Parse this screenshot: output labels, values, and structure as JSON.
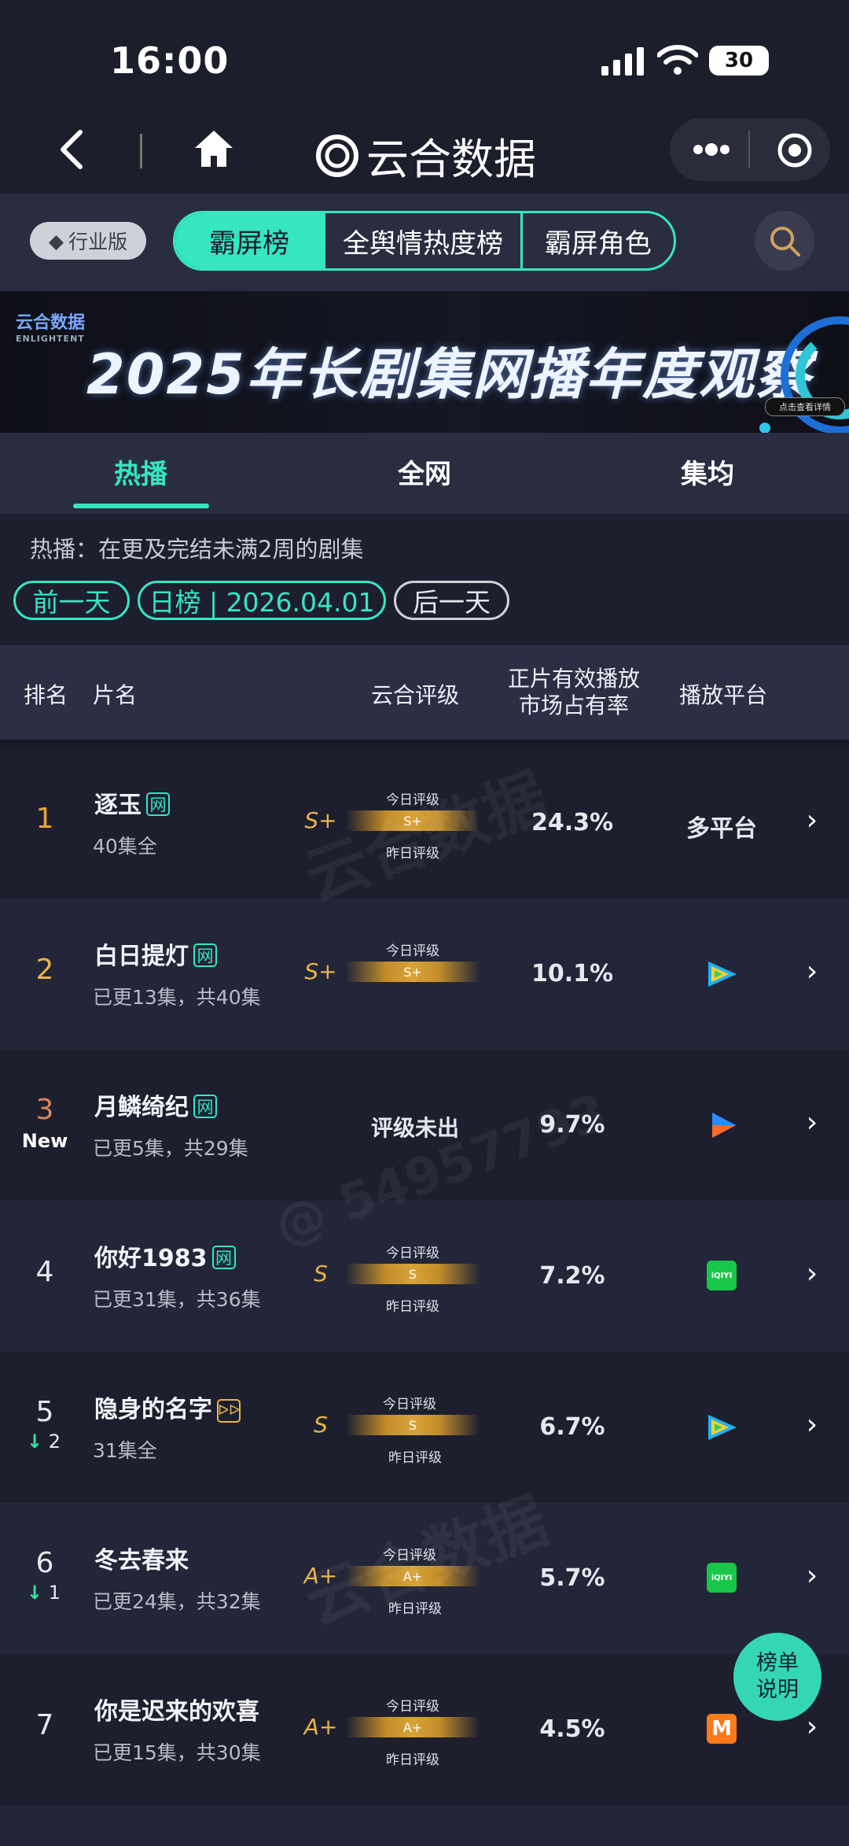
{
  "status": {
    "time": "16:00",
    "battery": "30"
  },
  "nav": {
    "title": "云合数据"
  },
  "toolbar": {
    "industry": "行业版",
    "segments": [
      "霸屏榜",
      "全舆情热度榜",
      "霸屏角色"
    ]
  },
  "banner": {
    "logo": "云合数据",
    "logo_sub": "ENLIGHTENT",
    "title": "2025年长剧集网播年度观察",
    "button": "点击查看详情"
  },
  "subtabs": [
    "热播",
    "全网",
    "集均"
  ],
  "filter": {
    "description": "热播：在更及完结未满2周的剧集",
    "prev": "前一天",
    "current": "日榜 | 2026.04.01",
    "next": "后一天"
  },
  "table_header": {
    "rank": "排名",
    "name": "片名",
    "rating": "云合评级",
    "share_line1": "正片有效播放",
    "share_line2": "市场占有率",
    "platform": "播放平台"
  },
  "rating_labels": {
    "today": "今日评级",
    "yesterday": "昨日评级"
  },
  "rows": [
    {
      "rank": "1",
      "rank_color": "#e8a33a",
      "title": "逐玉",
      "badge": "网",
      "sub": "40集全",
      "grade": "S+",
      "today": "S+",
      "yesterday": "昨日评级",
      "share": "24.3%",
      "platform": "多平台"
    },
    {
      "rank": "2",
      "rank_color": "#e8b44a",
      "title": "白日提灯",
      "badge": "网",
      "sub": "已更13集，共40集",
      "grade": "S+",
      "today": "S+",
      "yesterday": "",
      "share": "10.1%",
      "platform": "tencent-video-icon"
    },
    {
      "rank": "3",
      "rank_color": "#d9865a",
      "change": "New",
      "title": "月鳞绮纪",
      "badge": "网",
      "sub": "已更5集，共29集",
      "rating_text": "评级未出",
      "share": "9.7%",
      "platform": "youku-icon"
    },
    {
      "rank": "4",
      "title": "你好1983",
      "badge": "网",
      "sub": "已更31集，共36集",
      "grade": "S",
      "today": "S",
      "yesterday": "昨日评级",
      "share": "7.2%",
      "platform": "iqiyi-icon"
    },
    {
      "rank": "5",
      "change": "2",
      "title": "隐身的名字",
      "badge": "ᐅᐅ",
      "sub": "31集全",
      "grade": "S",
      "today": "S",
      "yesterday": "昨日评级",
      "share": "6.7%",
      "platform": "tencent-video-icon"
    },
    {
      "rank": "6",
      "change": "1",
      "title": "冬去春来",
      "sub": "已更24集，共32集",
      "grade": "A+",
      "today": "A+",
      "yesterday": "昨日评级",
      "share": "5.7%",
      "platform": "iqiyi-icon"
    },
    {
      "rank": "7",
      "title": "你是迟来的欢喜",
      "sub": "已更15集，共30集",
      "grade": "A+",
      "today": "A+",
      "yesterday": "昨日评级",
      "share": "4.5%",
      "platform": "mango-tv-icon"
    }
  ],
  "iqiyi_label": "iQIYI",
  "mango_label": "M",
  "floating": {
    "line1": "榜单",
    "line2": "说明"
  },
  "watermark": {
    "brand": "云合数据",
    "brand_en": "ENLIGHTENT",
    "id": "@ 54957793"
  },
  "colors": {
    "accent": "#35e6c0",
    "gold": "#e8b44a",
    "bg": "#1d1f2e",
    "row_alt": "#232638"
  }
}
